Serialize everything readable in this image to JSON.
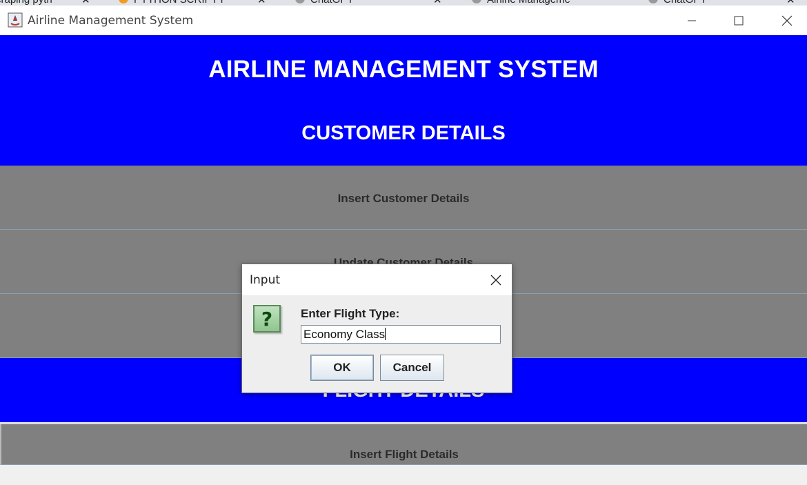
{
  "browser_tabs": [
    {
      "label": "craping pyth",
      "close": "✕"
    },
    {
      "label": "PYTHON SCRIPT F",
      "close": "✕"
    },
    {
      "label": "ChatGPT",
      "close": "✕"
    },
    {
      "label": "Airline Manageme",
      "close": ""
    },
    {
      "label": "ChatGPT",
      "close": "✕"
    }
  ],
  "window": {
    "title": "Airline Management System",
    "icon": "java-app-icon",
    "controls": [
      "minimize",
      "maximize",
      "close"
    ]
  },
  "app": {
    "main_title": "AIRLINE MANAGEMENT SYSTEM",
    "customer_section": {
      "title": "CUSTOMER DETAILS",
      "buttons": [
        "Insert Customer Details",
        "Update Customer Details",
        ""
      ]
    },
    "flight_section": {
      "title": "FLIGHT DETAILS",
      "buttons": [
        "Insert Flight Details"
      ]
    }
  },
  "dialog": {
    "title": "Input",
    "icon": "question-icon",
    "prompt": "Enter Flight Type:",
    "input_value": "Economy Class",
    "ok_label": "OK",
    "cancel_label": "Cancel"
  },
  "colors": {
    "banner_blue": "#0000ff",
    "button_grey": "#808080",
    "question_icon_green": "#8fc48f"
  }
}
